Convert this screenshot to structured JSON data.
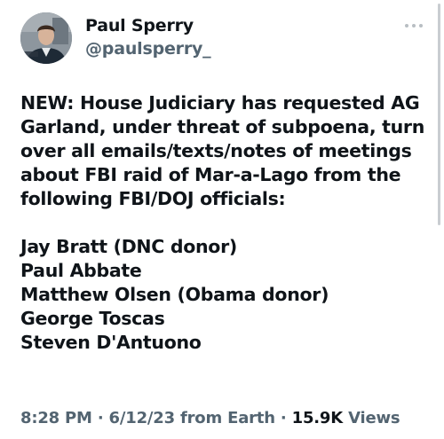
{
  "author": {
    "display_name": "Paul Sperry",
    "handle": "@paulsperry_"
  },
  "menu": {
    "icon": "more-horizontal-icon"
  },
  "tweet": {
    "lines": [
      "NEW: House Judiciary has requested AG",
      "Garland, under threat of subpoena, turn",
      "over all emails/texts/notes of meetings",
      "about FBI raid of Mar-a-Lago from the",
      "following FBI/DOJ officials:"
    ],
    "officials": [
      "Jay Bratt (DNC donor)",
      "Paul Abbate",
      "Matthew Olsen (Obama donor)",
      "George Toscas",
      "Steven D'Antuono"
    ]
  },
  "meta": {
    "time": "8:28 PM",
    "separator": "·",
    "date": "6/12/23",
    "source": "from Earth",
    "views_count": "15.9K",
    "views_label": "Views"
  },
  "colors": {
    "text": "#0f1419",
    "secondary": "#536471"
  }
}
